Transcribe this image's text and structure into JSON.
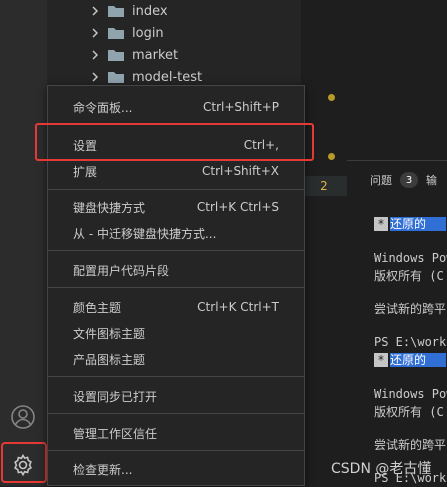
{
  "sidebar": {
    "folders": [
      "index",
      "login",
      "market",
      "model-test"
    ]
  },
  "editor": {
    "line_number": "2"
  },
  "panel": {
    "tab_label": "问题",
    "tab_badge": "3",
    "tab_overflow": "输"
  },
  "terminal": {
    "lines": [
      {
        "marker": "*",
        "text": "还原的"
      },
      {
        "text": "Windows Pow"
      },
      {
        "text": "版权所有 (C"
      },
      {
        "text": "尝试新的跨平"
      },
      {
        "text": "PS E:\\work\\"
      },
      {
        "marker": "*",
        "text": "还原的"
      },
      {
        "text": "Windows Pow"
      },
      {
        "text": "版权所有 (C"
      },
      {
        "text": "尝试新的跨平"
      },
      {
        "text": "PS E:\\work\\"
      }
    ]
  },
  "menu": {
    "items": [
      {
        "label": "命令面板...",
        "shortcut": "Ctrl+Shift+P"
      },
      {
        "label": "设置",
        "shortcut": "Ctrl+,"
      },
      {
        "label": "扩展",
        "shortcut": "Ctrl+Shift+X"
      },
      {
        "label": "键盘快捷方式",
        "shortcut": "Ctrl+K Ctrl+S"
      },
      {
        "label": "从 - 中迁移键盘快捷方式...",
        "shortcut": ""
      },
      {
        "label": "配置用户代码片段",
        "shortcut": ""
      },
      {
        "label": "颜色主题",
        "shortcut": "Ctrl+K Ctrl+T"
      },
      {
        "label": "文件图标主题",
        "shortcut": ""
      },
      {
        "label": "产品图标主题",
        "shortcut": ""
      },
      {
        "label": "设置同步已打开",
        "shortcut": ""
      },
      {
        "label": "管理工作区信任",
        "shortcut": ""
      },
      {
        "label": "检查更新...",
        "shortcut": ""
      }
    ]
  },
  "watermark": "CSDN @老古懂",
  "colors": {
    "highlight_border": "#e53935",
    "terminal_selection": "#2f6fd6",
    "modified_dot": "#b89a2a"
  },
  "icons": {
    "account": "account-icon",
    "manage": "gear-icon"
  }
}
